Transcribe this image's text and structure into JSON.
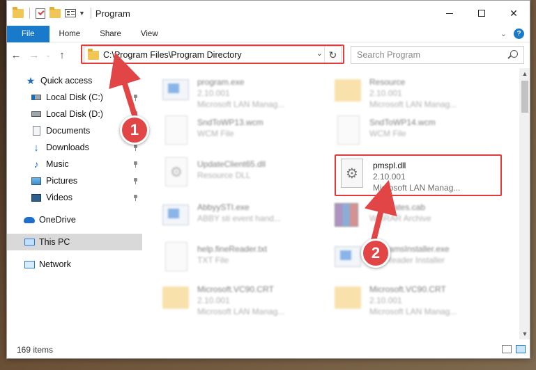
{
  "window": {
    "title": "Program"
  },
  "ribbon": {
    "tabs": [
      {
        "label": "File"
      },
      {
        "label": "Home"
      },
      {
        "label": "Share"
      },
      {
        "label": "View"
      }
    ]
  },
  "address": {
    "path": "C:\\Program Files\\Program Directory"
  },
  "search": {
    "placeholder": "Search Program"
  },
  "nav": {
    "items": [
      {
        "label": "Quick access",
        "icon": "star-icon"
      },
      {
        "label": "Local Disk (C:)",
        "icon": "disk-icon",
        "pinned": true
      },
      {
        "label": "Local Disk (D:)",
        "icon": "disk-icon",
        "pinned": true
      },
      {
        "label": "Documents",
        "icon": "documents-icon",
        "pinned": true
      },
      {
        "label": "Downloads",
        "icon": "downloads-icon",
        "pinned": true
      },
      {
        "label": "Music",
        "icon": "music-icon",
        "pinned": true
      },
      {
        "label": "Pictures",
        "icon": "pictures-icon",
        "pinned": true
      },
      {
        "label": "Videos",
        "icon": "videos-icon",
        "pinned": true
      },
      {
        "label": "OneDrive",
        "icon": "onedrive-icon"
      },
      {
        "label": "This PC",
        "icon": "this-pc-icon",
        "selected": true
      },
      {
        "label": "Network",
        "icon": "network-icon"
      }
    ]
  },
  "files": [
    {
      "name": "program.exe",
      "line2": "2.10.001",
      "line3": "Microsoft LAN Manag...",
      "type": "exe"
    },
    {
      "name": "Resource",
      "line2": "2.10.001",
      "line3": "Microsoft LAN Manag...",
      "type": "folder"
    },
    {
      "name": "SndToWP13.wcm",
      "line2": "WCM File",
      "line3": "",
      "type": "file"
    },
    {
      "name": "SndToWP14.wcm",
      "line2": "WCM File",
      "line3": "",
      "type": "file"
    },
    {
      "name": "UpdateClient65.dll",
      "line2": "Resource DLL",
      "line3": "",
      "type": "dll"
    },
    {
      "name": "pmspl.dll",
      "line2": "2.10.001",
      "line3": "Microsoft LAN Manag...",
      "type": "dll"
    },
    {
      "name": "AbbyySTI.exe",
      "line2": "ABBY sti event hand...",
      "line3": "",
      "type": "exe"
    },
    {
      "name": "certificates.cab",
      "line2": "WinRAR Archive",
      "line3": "",
      "type": "rar"
    },
    {
      "name": "help.fineReader.txt",
      "line2": "TXT File",
      "line3": "",
      "type": "file"
    },
    {
      "name": "programsInstaller.exe",
      "line2": "FineReader Installer",
      "line3": "",
      "type": "exe"
    },
    {
      "name": "Microsoft.VC90.CRT",
      "line2": "2.10.001",
      "line3": "Microsoft LAN Manag...",
      "type": "folder"
    },
    {
      "name": "Microsoft.VC90.CRT",
      "line2": "2.10.001",
      "line3": "Microsoft LAN Manag...",
      "type": "folder"
    }
  ],
  "status": {
    "item_count": "169 items"
  },
  "annotations": {
    "step1": "1",
    "step2": "2"
  },
  "colors": {
    "accent": "#1979ca",
    "highlight": "#e33b3b",
    "selected_nav": "#d9d9d9"
  }
}
